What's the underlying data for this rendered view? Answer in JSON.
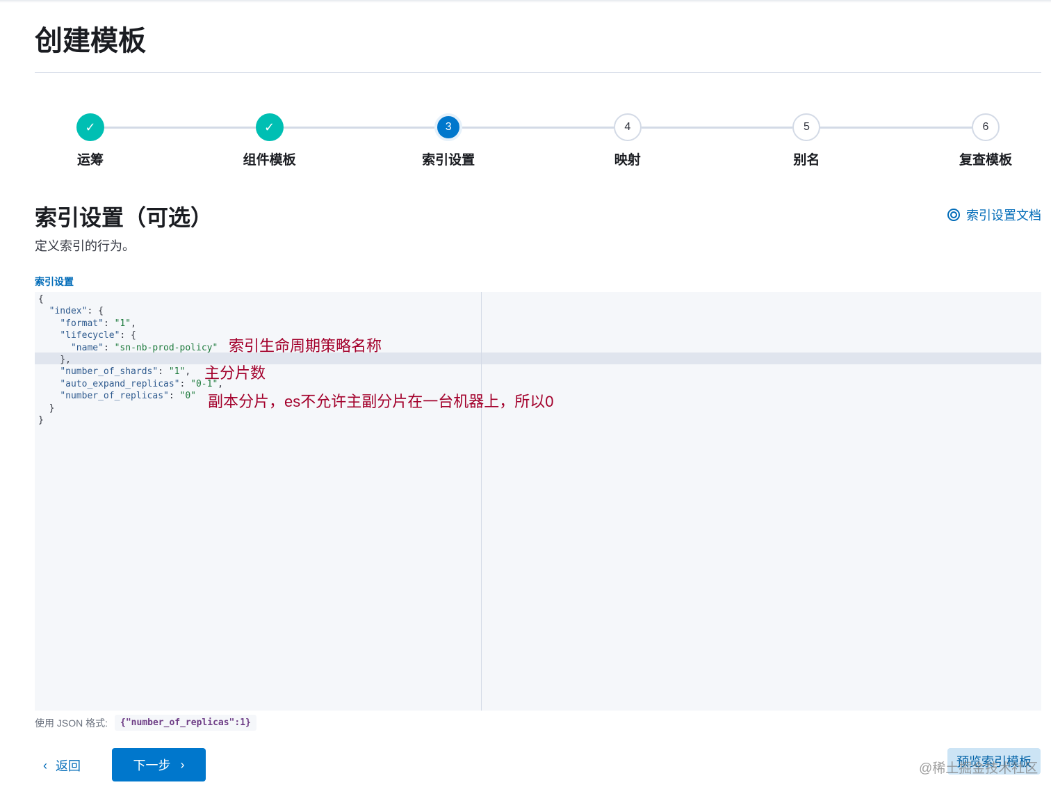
{
  "title": "创建模板",
  "steps": [
    {
      "label": "运筹",
      "status": "done",
      "num": "1"
    },
    {
      "label": "组件模板",
      "status": "done",
      "num": "2"
    },
    {
      "label": "索引设置",
      "status": "current",
      "num": "3"
    },
    {
      "label": "映射",
      "status": "todo",
      "num": "4"
    },
    {
      "label": "别名",
      "status": "todo",
      "num": "5"
    },
    {
      "label": "复查模板",
      "status": "todo",
      "num": "6"
    }
  ],
  "section": {
    "title": "索引设置（可选）",
    "description": "定义索引的行为。",
    "doc_link": "索引设置文档",
    "field_label": "索引设置"
  },
  "code_lines": [
    {
      "i": "",
      "k": "",
      "v": "",
      "p": "{"
    },
    {
      "i": "  ",
      "k": "\"index\"",
      "p2": ": {"
    },
    {
      "i": "    ",
      "k": "\"format\"",
      "v": "\"1\"",
      "t": ","
    },
    {
      "i": "    ",
      "k": "\"lifecycle\"",
      "p2": ": {"
    },
    {
      "i": "      ",
      "k": "\"name\"",
      "v": "\"sn-nb-prod-policy\"",
      "t": ""
    },
    {
      "i": "    ",
      "p": "},"
    },
    {
      "i": "    ",
      "k": "\"number_of_shards\"",
      "v": "\"1\"",
      "t": ","
    },
    {
      "i": "    ",
      "k": "\"auto_expand_replicas\"",
      "v": "\"0-1\"",
      "t": ","
    },
    {
      "i": "    ",
      "k": "\"number_of_replicas\"",
      "v": "\"0\"",
      "t": ""
    },
    {
      "i": "  ",
      "p": "}"
    },
    {
      "i": "",
      "p": "}"
    }
  ],
  "annotations": {
    "lifecycle": "索引生命周期策略名称",
    "shards": "主分片数",
    "replicas": "副本分片，es不允许主副分片在一台机器上，所以0"
  },
  "help": {
    "label": "使用 JSON 格式:",
    "example": "{\"number_of_replicas\":1}"
  },
  "buttons": {
    "back": "返回",
    "next": "下一步",
    "preview": "预览索引模板"
  },
  "watermark": "@稀土掘金技术社区"
}
